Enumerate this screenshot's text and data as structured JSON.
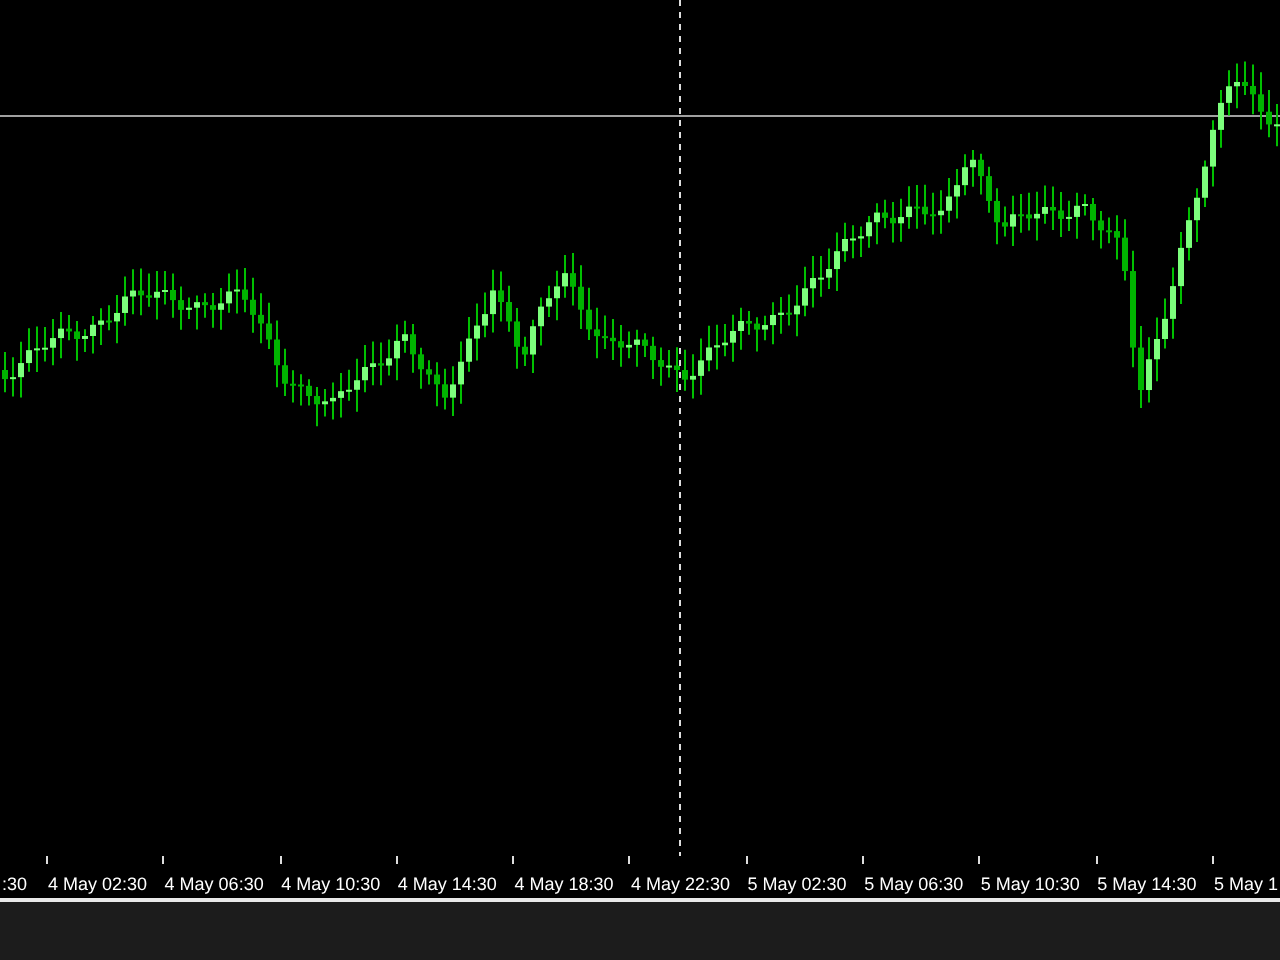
{
  "chart": {
    "x_axis_labels": [
      ":30",
      "4 May 02:30",
      "4 May 06:30",
      "4 May 10:30",
      "4 May 14:30",
      "4 May 18:30",
      "4 May 22:30",
      "5 May 02:30",
      "5 May 06:30",
      "5 May 10:30",
      "5 May 14:30",
      "5 May 1"
    ]
  }
}
